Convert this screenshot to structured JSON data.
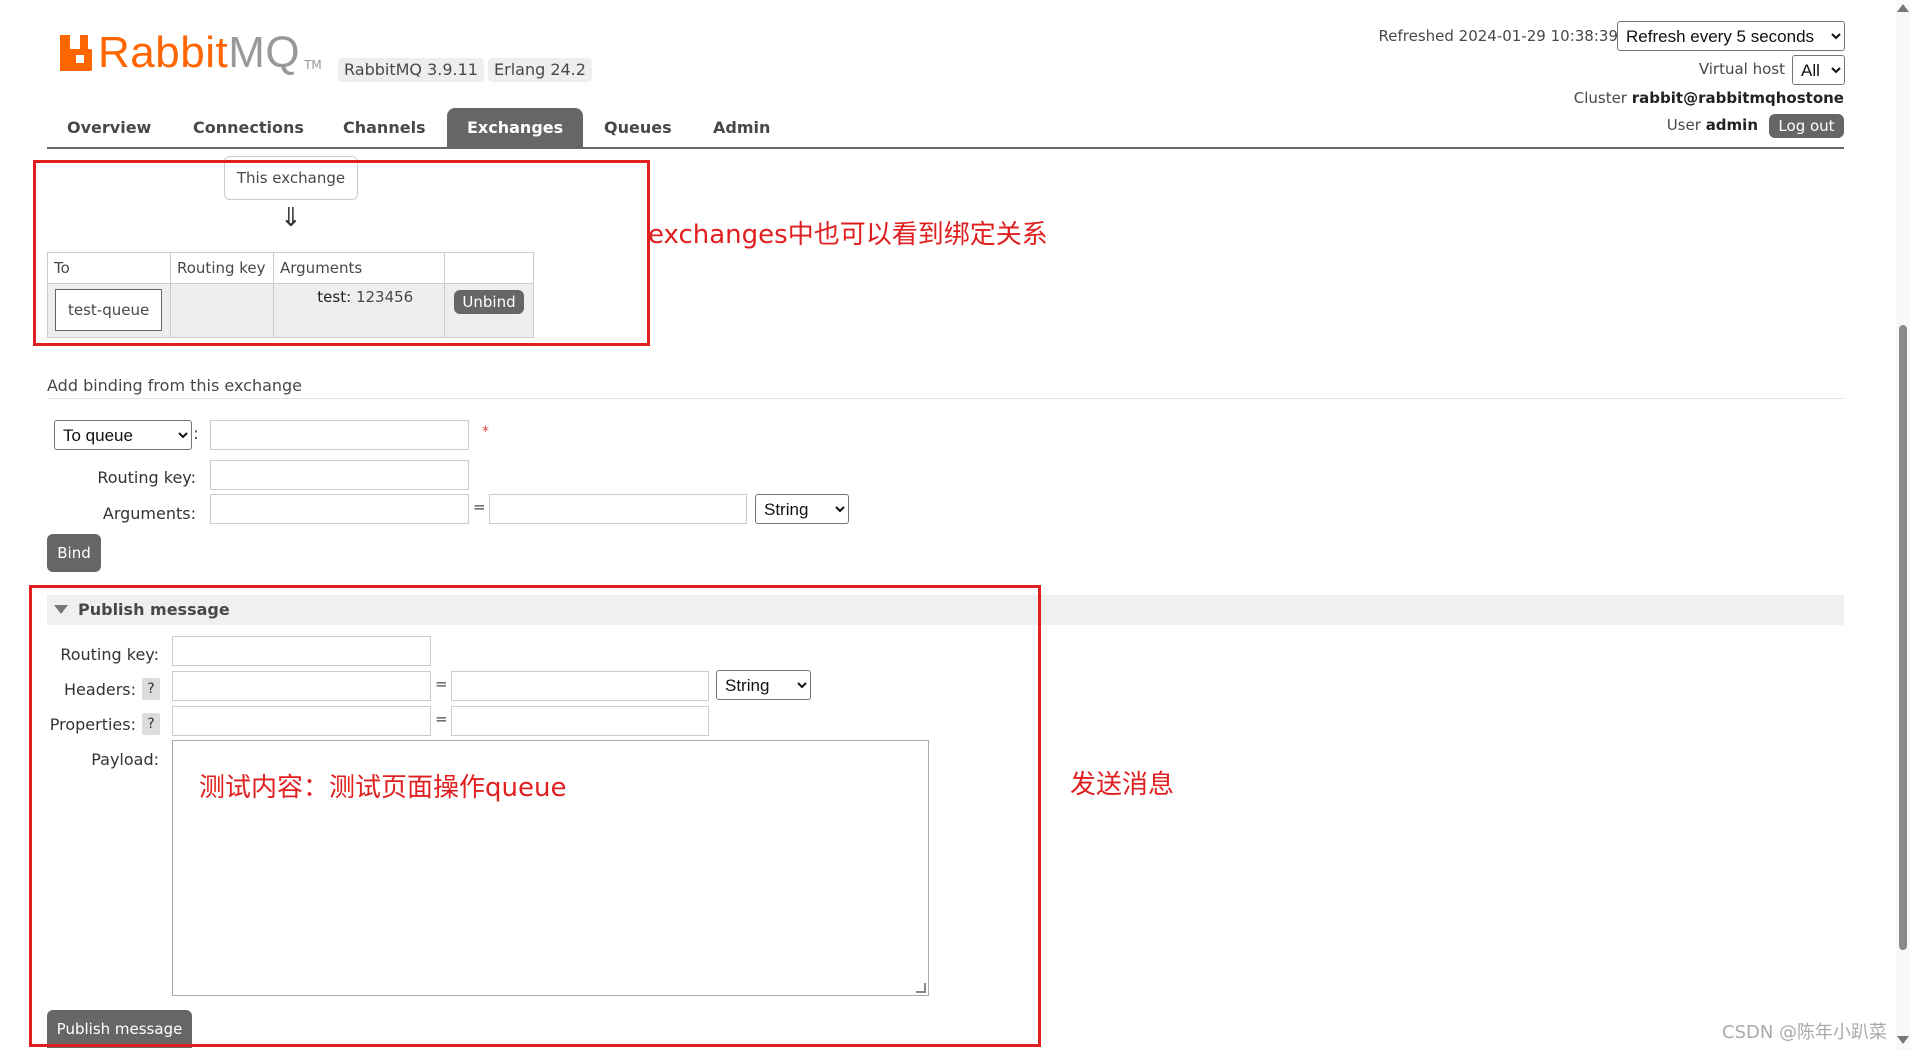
{
  "header": {
    "logo": {
      "prefix": "Rabbit",
      "suffix": "MQ",
      "tm": "TM"
    },
    "version": "RabbitMQ 3.9.11",
    "erlang": "Erlang 24.2",
    "refreshed_label": "Refreshed 2024-01-29 10:38:39",
    "refresh_option": "Refresh every 5 seconds",
    "vhost_label": "Virtual host",
    "vhost_value": "All",
    "cluster_label": "Cluster",
    "cluster_value": "rabbit@rabbitmqhostone",
    "user_label": "User",
    "user_value": "admin",
    "logout": "Log out"
  },
  "nav": {
    "tabs": [
      "Overview",
      "Connections",
      "Channels",
      "Exchanges",
      "Queues",
      "Admin"
    ],
    "active": "Exchanges"
  },
  "bindings": {
    "this_exchange": "This exchange",
    "arrow": "⇓",
    "columns": [
      "To",
      "Routing key",
      "Arguments",
      ""
    ],
    "row": {
      "to": "test-queue",
      "routing_key": "",
      "arg_key": "test:",
      "arg_value": "123456",
      "unbind": "Unbind"
    }
  },
  "add_binding": {
    "title": "Add binding from this exchange",
    "destination_type": "To queue",
    "required_mark": "*",
    "routing_key_label": "Routing key:",
    "arguments_label": "Arguments:",
    "equals": "=",
    "arg_type": "String",
    "bind_button": "Bind"
  },
  "publish": {
    "title": "Publish message",
    "routing_key_label": "Routing key:",
    "headers_label": "Headers:",
    "properties_label": "Properties:",
    "help": "?",
    "equals": "=",
    "header_type": "String",
    "payload_label": "Payload:",
    "payload_value": "测试内容：测试页面操作queue",
    "publish_button": "Publish message"
  },
  "annotations": {
    "bindings_note": "exchanges中也可以看到绑定关系",
    "publish_note": "发送消息",
    "color": "#e02020"
  },
  "watermark": "CSDN @陈年小趴菜"
}
